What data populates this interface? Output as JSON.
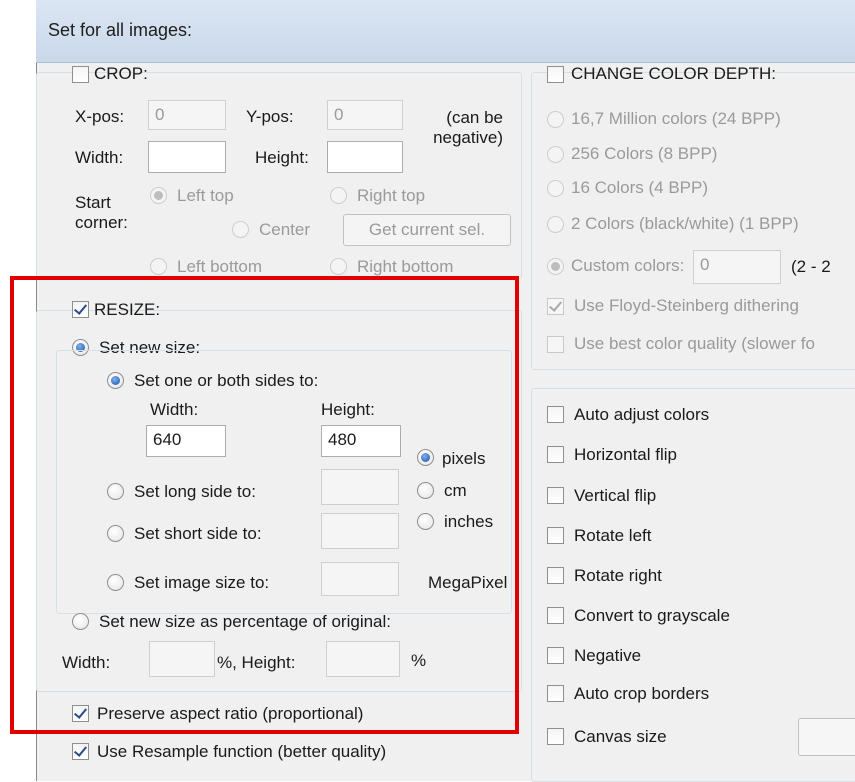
{
  "dialog": {
    "title": "Set for all images:"
  },
  "crop": {
    "label": "CROP:",
    "xpos_label": "X-pos:",
    "xpos_value": "0",
    "ypos_label": "Y-pos:",
    "ypos_value": "0",
    "note": "(can be negative)",
    "width_label": "Width:",
    "height_label": "Height:",
    "start_corner_label": "Start corner:",
    "left_top": "Left top",
    "right_top": "Right top",
    "center": "Center",
    "get_current_sel": "Get current sel.",
    "left_bottom": "Left bottom",
    "right_bottom": "Right bottom"
  },
  "resize": {
    "label": "RESIZE:",
    "set_new_size": "Set new size:",
    "set_one_or_both": "Set one or both sides to:",
    "width_label": "Width:",
    "height_label": "Height:",
    "width_value": "640",
    "height_value": "480",
    "pixels": "pixels",
    "cm": "cm",
    "inches": "inches",
    "set_long_side": "Set long side to:",
    "set_short_side": "Set short side to:",
    "set_image_size": "Set image size to:",
    "megapixel": "MegaPixel",
    "percentage": "Set new size as percentage of original:",
    "pct_width_label": "Width:",
    "pct_height_label": "%, Height:",
    "pct_suffix": "%",
    "preserve_aspect": "Preserve aspect ratio (proportional)"
  },
  "use_resample": "Use Resample function (better quality)",
  "color_depth": {
    "label": "CHANGE COLOR DEPTH:",
    "opt_24": "16,7 Million colors (24 BPP)",
    "opt_8": "256 Colors (8 BPP)",
    "opt_4": "16 Colors (4 BPP)",
    "opt_1": "2 Colors (black/white) (1 BPP)",
    "custom": "Custom colors:",
    "custom_value": "0",
    "custom_range": "(2 - 2",
    "floyd": "Use Floyd-Steinberg dithering",
    "best_quality": "Use best color quality (slower fo"
  },
  "options": {
    "auto_adjust": "Auto adjust colors",
    "horizontal_flip": "Horizontal flip",
    "vertical_flip": "Vertical flip",
    "rotate_left": "Rotate left",
    "rotate_right": "Rotate right",
    "grayscale": "Convert to grayscale",
    "negative": "Negative",
    "auto_crop": "Auto crop borders",
    "canvas_size": "Canvas size"
  },
  "colors": {
    "highlight": "#e00000",
    "radio_selected": "#1d4fa8"
  }
}
